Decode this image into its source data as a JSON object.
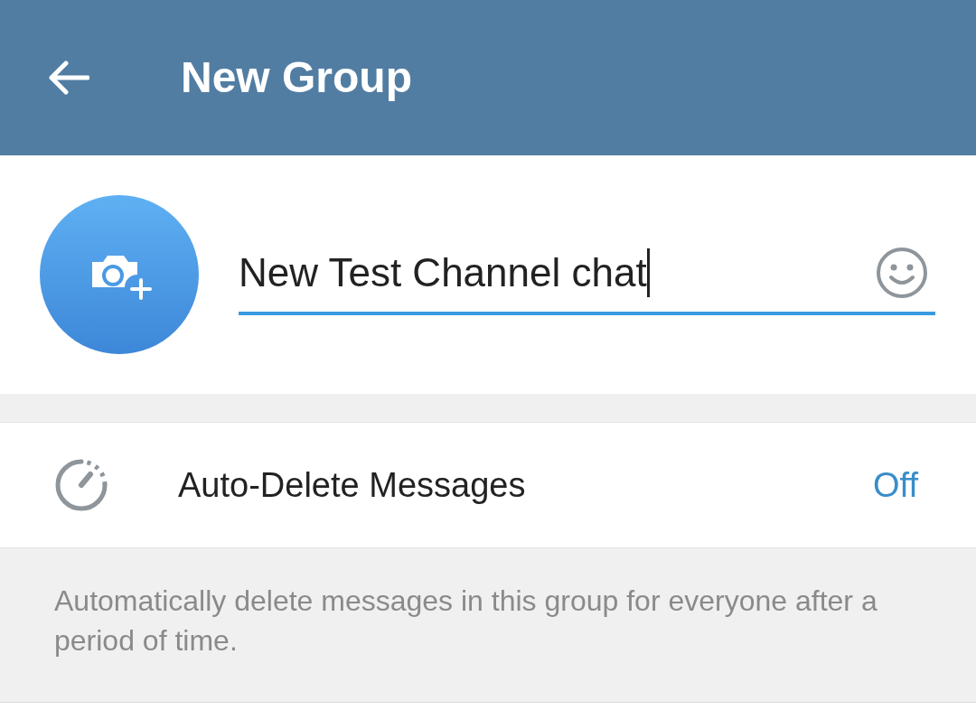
{
  "header": {
    "title": "New Group"
  },
  "name_field": {
    "value": "New Test Channel chat",
    "focused": true
  },
  "settings": [
    {
      "label": "Auto-Delete Messages",
      "value": "Off"
    }
  ],
  "footer_note": "Automatically delete messages in this group for everyone after a period of time."
}
